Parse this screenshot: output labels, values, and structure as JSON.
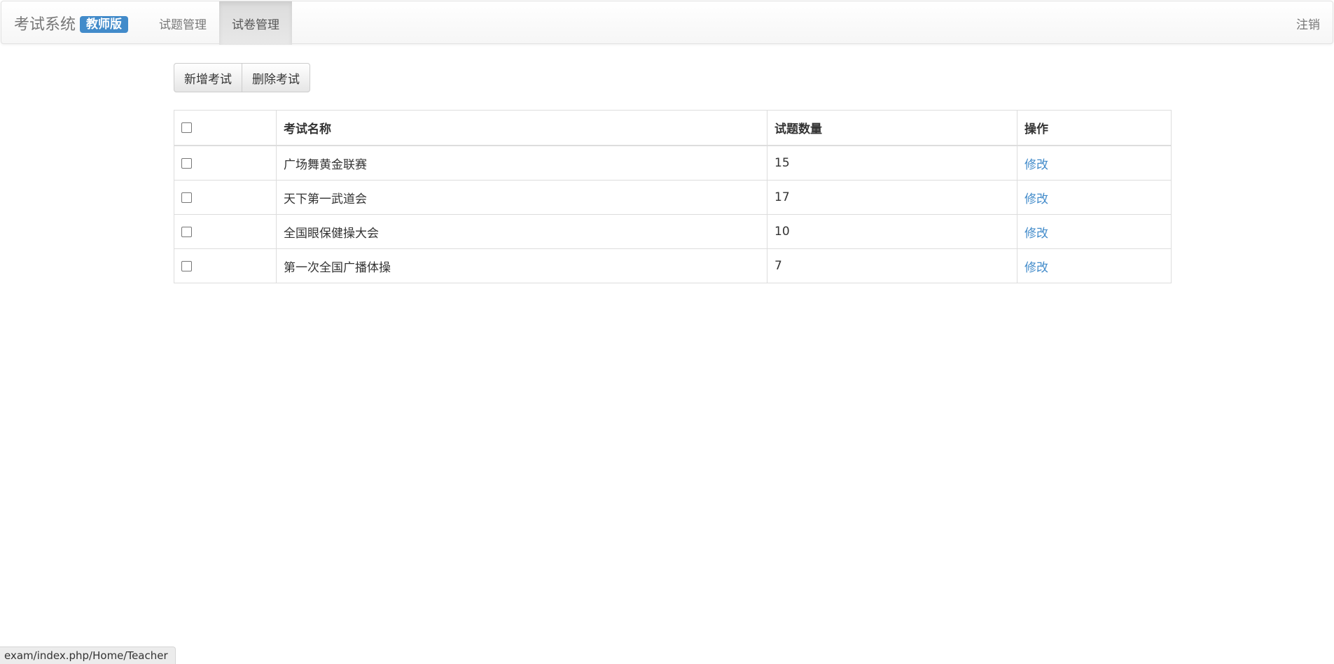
{
  "navbar": {
    "brand": "考试系统",
    "badge": "教师版",
    "items": [
      {
        "label": "试题管理"
      },
      {
        "label": "试卷管理"
      }
    ],
    "logout": "注销"
  },
  "toolbar": {
    "add_label": "新增考试",
    "delete_label": "删除考试"
  },
  "table": {
    "headers": {
      "name": "考试名称",
      "count": "试题数量",
      "action": "操作"
    },
    "rows": [
      {
        "name": "广场舞黄金联赛",
        "count": "15",
        "action": "修改"
      },
      {
        "name": "天下第一武道会",
        "count": "17",
        "action": "修改"
      },
      {
        "name": "全国眼保健操大会",
        "count": "10",
        "action": "修改"
      },
      {
        "name": "第一次全国广播体操",
        "count": "7",
        "action": "修改"
      }
    ]
  },
  "status_bar": {
    "url": "exam/index.php/Home/Teacher"
  },
  "colors": {
    "accent": "#428bca",
    "nav_active_bg": "#e0e0e0"
  }
}
